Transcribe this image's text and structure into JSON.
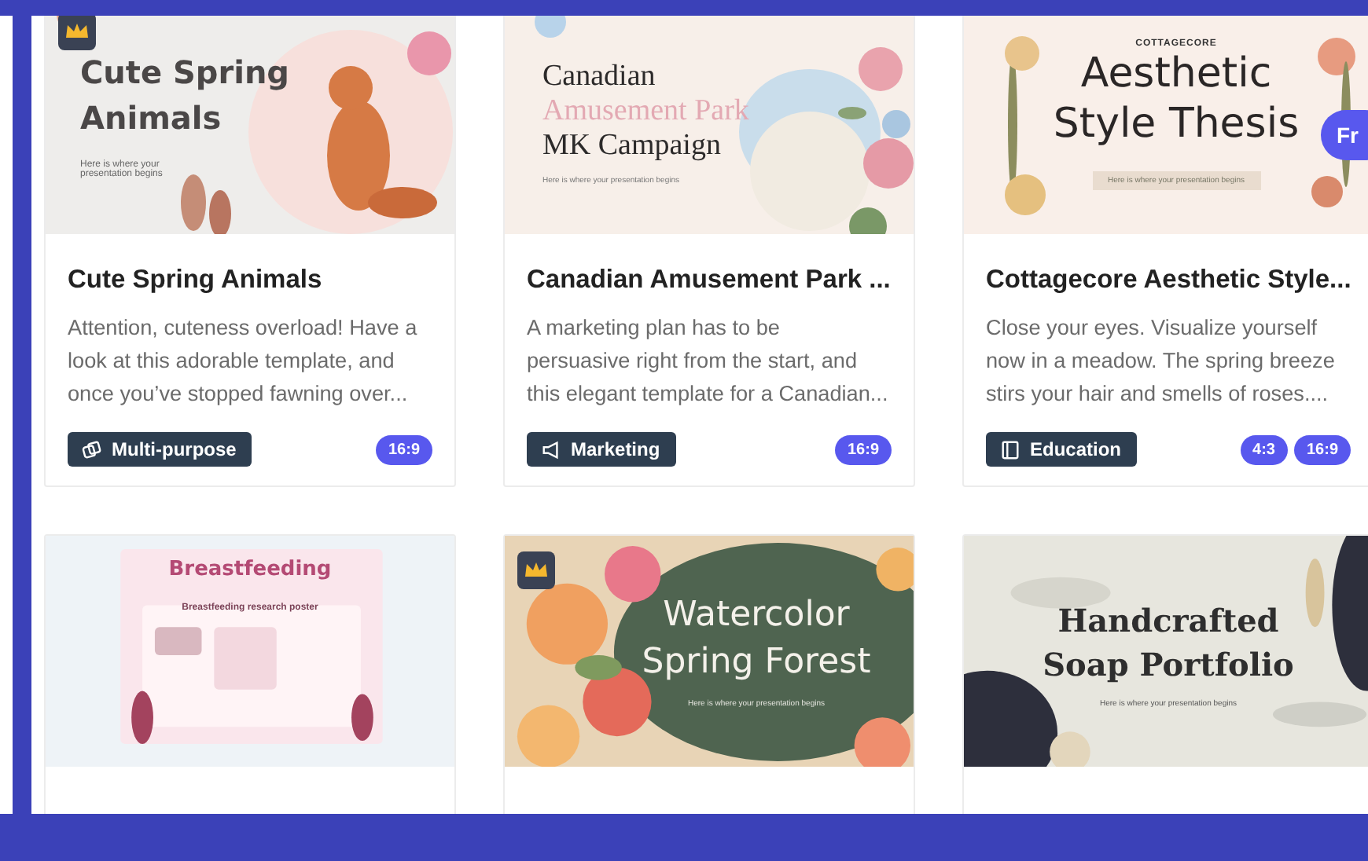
{
  "cards": [
    {
      "premium": true,
      "slide": [
        {
          "kind": "title",
          "text": "Cute Spring"
        },
        {
          "kind": "title",
          "text": "Animals"
        },
        {
          "kind": "tagline",
          "text": "Here is where your presentation begins"
        }
      ],
      "title": "Cute Spring Animals",
      "description": "Attention, cuteness overload! Have a\nlook at this adorable template, and\nonce you’ve stopped fawning over...",
      "category": "Multi-purpose",
      "ratios": [
        "16:9"
      ]
    },
    {
      "premium": false,
      "slide": [
        {
          "kind": "title",
          "text": "Canadian"
        },
        {
          "kind": "accent",
          "text": "Amusement Park"
        },
        {
          "kind": "title",
          "text": "MK Campaign"
        },
        {
          "kind": "tagline",
          "text": "Here is where your presentation begins"
        }
      ],
      "title": "Canadian Amusement Park ...",
      "description": "A marketing plan has to be\npersuasive right from the start, and\nthis elegant template for a Canadian...",
      "category": "Marketing",
      "ratios": [
        "16:9"
      ]
    },
    {
      "premium": false,
      "slide": [
        {
          "kind": "eyebrow",
          "text": "COTTAGECORE"
        },
        {
          "kind": "title",
          "text": "Aesthetic"
        },
        {
          "kind": "title",
          "text": "Style Thesis"
        },
        {
          "kind": "tagline",
          "text": "Here is where your presentation begins"
        }
      ],
      "title": "Cottagecore Aesthetic Style...",
      "description": "Close your eyes. Visualize yourself\nnow in a meadow. The spring breeze\nstirs your hair and smells of roses....",
      "category": "Education",
      "ratios": [
        "4:3",
        "16:9"
      ]
    },
    {
      "premium": false,
      "slide": [
        {
          "kind": "title",
          "text": "Breastfeeding"
        },
        {
          "kind": "tagline",
          "text": "Breastfeeding research poster"
        }
      ]
    },
    {
      "premium": true,
      "slide": [
        {
          "kind": "title",
          "text": "Watercolor"
        },
        {
          "kind": "title",
          "text": "Spring Forest"
        },
        {
          "kind": "tagline",
          "text": "Here is where your presentation begins"
        }
      ]
    },
    {
      "premium": false,
      "slide": [
        {
          "kind": "title",
          "text": "Handcrafted"
        },
        {
          "kind": "title",
          "text": "Soap Portfolio"
        },
        {
          "kind": "tagline",
          "text": "Here is where your presentation begins"
        }
      ]
    }
  ],
  "side_button": {
    "label": "Fr"
  }
}
